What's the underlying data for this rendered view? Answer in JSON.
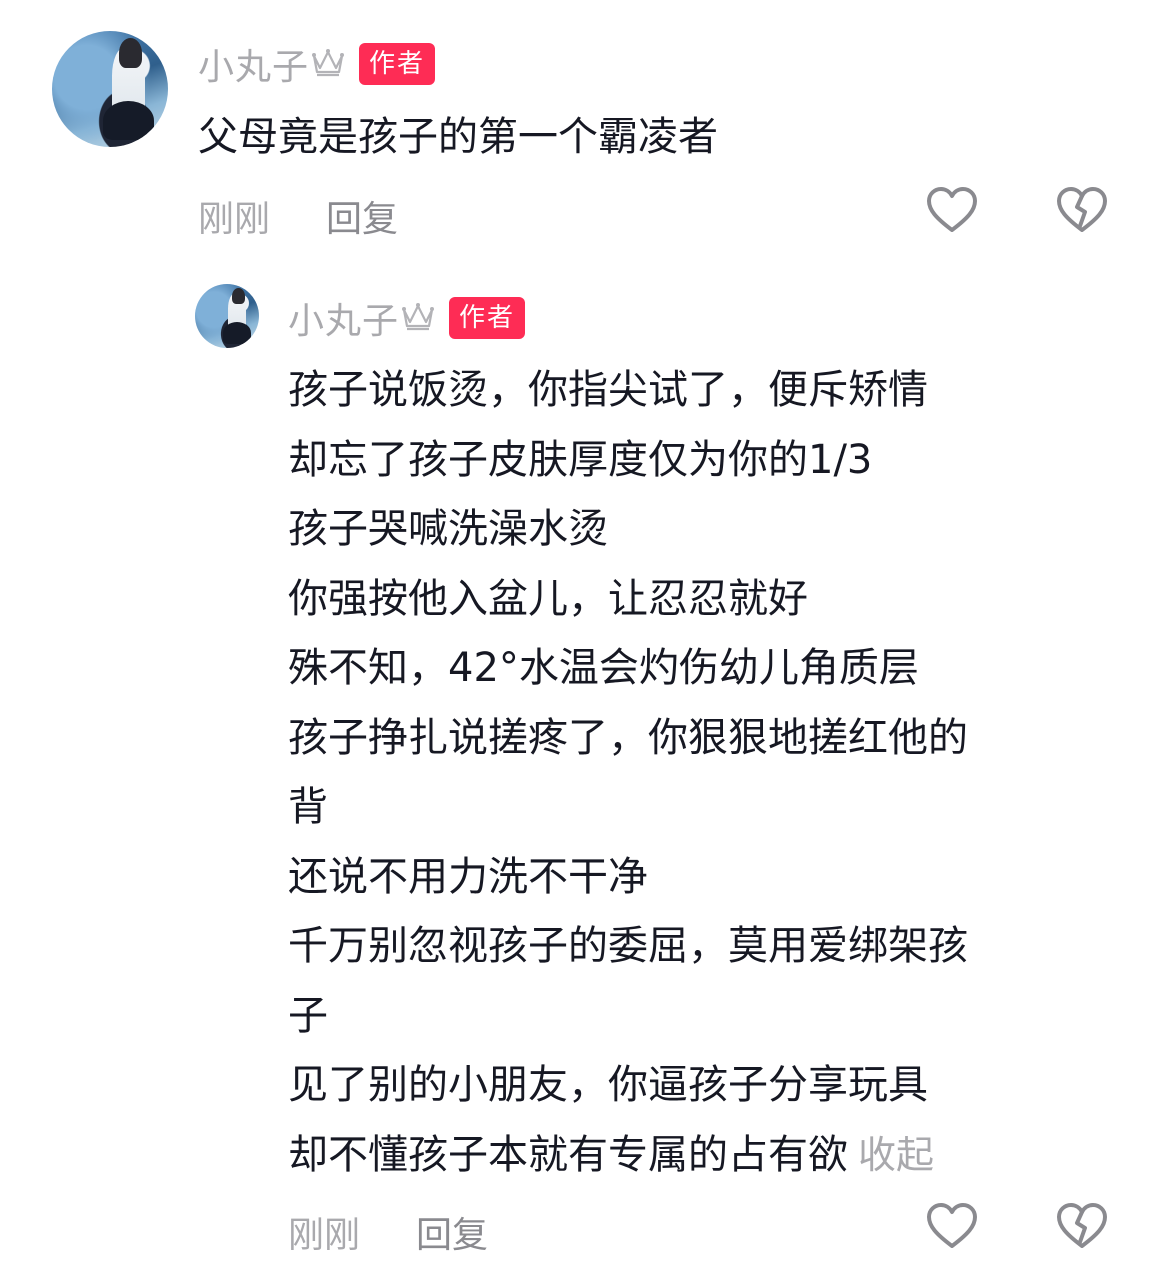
{
  "comment": {
    "username": "小丸子",
    "badge": "作者",
    "text": "父母竟是孩子的第一个霸凌者",
    "time": "刚刚",
    "reply_label": "回复"
  },
  "reply": {
    "username": "小丸子",
    "badge": "作者",
    "lines": [
      "孩子说饭烫，你指尖试了，便斥矫情",
      "却忘了孩子皮肤厚度仅为你的1/3",
      "孩子哭喊洗澡水烫",
      "你强按他入盆儿，让忍忍就好",
      "殊不知，42°水温会灼伤幼儿角质层",
      "孩子挣扎说搓疼了，你狠狠地搓红他的",
      "背",
      "还说不用力洗不干净",
      "千万别忽视孩子的委屈，莫用爱绑架孩",
      "子",
      "见了别的小朋友，你逼孩子分享玩具",
      "却不懂孩子本就有专属的占有欲"
    ],
    "collapse_label": "收起",
    "time": "刚刚",
    "reply_label": "回复"
  },
  "colors": {
    "badge": "#fe2c55",
    "muted": "#a9a9ad",
    "text": "#161823"
  },
  "icons": [
    "crown-icon",
    "like-heart-icon",
    "dislike-broken-heart-icon"
  ]
}
